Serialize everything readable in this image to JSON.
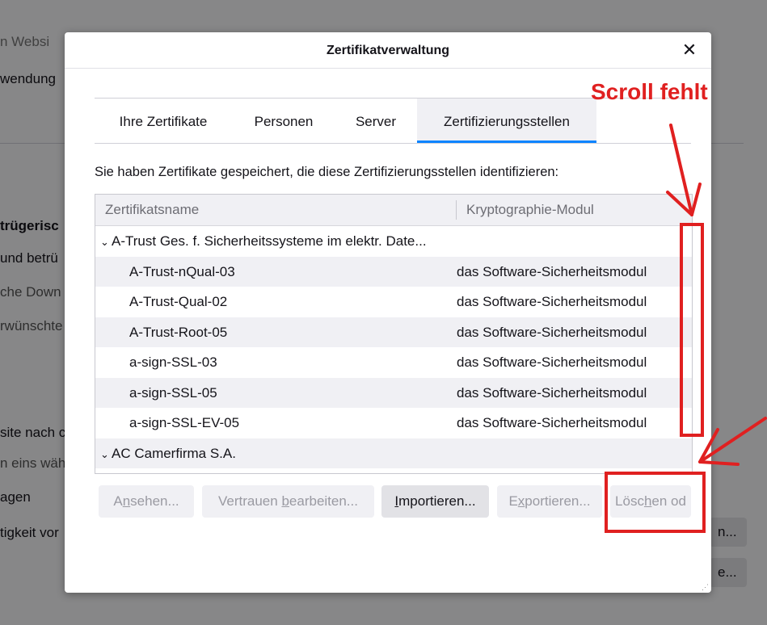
{
  "background": {
    "fragments": [
      "n Websi",
      "wendung",
      "trügerisc",
      "und betrü",
      "che Down",
      "rwünschte",
      "site nach c",
      "n eins wäh",
      "agen",
      "tigkeit vor",
      "n...",
      "e..."
    ]
  },
  "dialog": {
    "title": "Zertifikatverwaltung",
    "close_glyph": "✕",
    "tabs": [
      {
        "label": "Ihre Zertifikate",
        "active": false
      },
      {
        "label": "Personen",
        "active": false
      },
      {
        "label": "Server",
        "active": false
      },
      {
        "label": "Zertifizierungsstellen",
        "active": true
      }
    ],
    "intro": "Sie haben Zertifikate gespeichert, die diese Zertifizierungsstellen identifizieren:",
    "columns": [
      "Zertifikatsname",
      "Kryptographie-Modul"
    ],
    "rows": [
      {
        "name": "A-Trust Ges. f. Sicherheitssysteme im elektr. Date...",
        "module": "",
        "group": true
      },
      {
        "name": "A-Trust-nQual-03",
        "module": "das Software-Sicherheitsmodul",
        "group": false
      },
      {
        "name": "A-Trust-Qual-02",
        "module": "das Software-Sicherheitsmodul",
        "group": false
      },
      {
        "name": "A-Trust-Root-05",
        "module": "das Software-Sicherheitsmodul",
        "group": false
      },
      {
        "name": "a-sign-SSL-03",
        "module": "das Software-Sicherheitsmodul",
        "group": false
      },
      {
        "name": "a-sign-SSL-05",
        "module": "das Software-Sicherheitsmodul",
        "group": false
      },
      {
        "name": "a-sign-SSL-EV-05",
        "module": "das Software-Sicherheitsmodul",
        "group": false
      },
      {
        "name": "AC Camerfirma S.A.",
        "module": "",
        "group": true
      }
    ],
    "buttons": [
      {
        "pre": "A",
        "key": "n",
        "post": "sehen...",
        "enabled": false
      },
      {
        "pre": "Vertrauen ",
        "key": "b",
        "post": "earbeiten...",
        "enabled": false
      },
      {
        "pre": "",
        "key": "I",
        "post": "mportieren...",
        "enabled": true
      },
      {
        "pre": "E",
        "key": "x",
        "post": "portieren...",
        "enabled": false
      },
      {
        "pre": "Lösc",
        "key": "h",
        "post": "en od",
        "enabled": false
      }
    ]
  },
  "annotation": {
    "text": "Scroll fehlt",
    "color": "#e02020"
  },
  "accent": "#0a84ff"
}
